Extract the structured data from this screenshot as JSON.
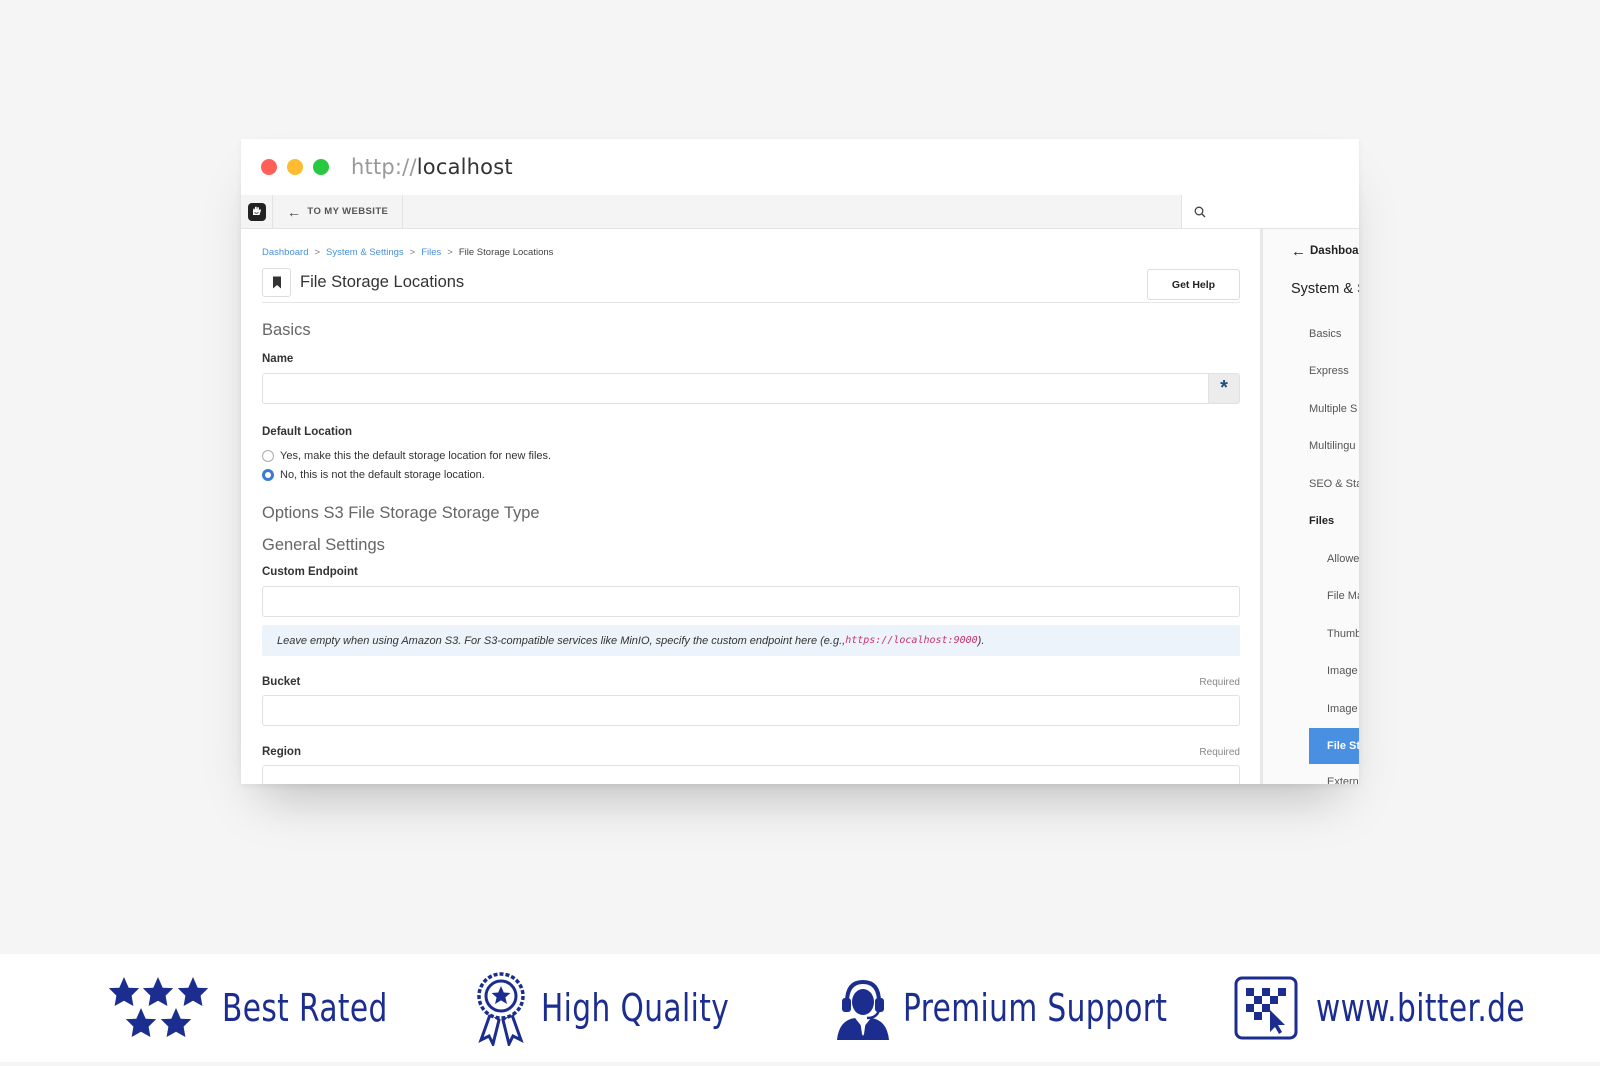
{
  "browser": {
    "url_protocol": "http://",
    "url_host": "localhost",
    "dots": [
      "#ff5f57",
      "#febc2e",
      "#28c840"
    ]
  },
  "toolbar": {
    "back_label": "TO MY WEBSITE",
    "back_icon": "arrow-left-icon",
    "search_icon": "search-icon"
  },
  "breadcrumb": {
    "items": [
      "Dashboard",
      "System & Settings",
      "Files"
    ],
    "separator": ">",
    "current": "File Storage Locations"
  },
  "page": {
    "title": "File Storage Locations",
    "help_button": "Get Help"
  },
  "form": {
    "section_basics": "Basics",
    "name_label": "Name",
    "required_marker": "*",
    "default_location_label": "Default Location",
    "radio_yes": "Yes, make this the default storage location for new files.",
    "radio_no": "No, this is not the default storage location.",
    "radio_selected": "no",
    "section_options": "Options S3 File Storage Storage Type",
    "section_general": "General Settings",
    "custom_endpoint_label": "Custom Endpoint",
    "endpoint_help_before": "Leave empty when using Amazon S3. For S3-compatible services like MinIO, specify the custom endpoint here (e.g., ",
    "endpoint_help_code": "https://localhost:9000",
    "endpoint_help_after": ").",
    "bucket_label": "Bucket",
    "bucket_required": "Required",
    "region_label": "Region",
    "region_required": "Required"
  },
  "sidebar": {
    "back_label": "Dashboar",
    "title": "System & S",
    "items": [
      {
        "label": "Basics"
      },
      {
        "label": "Express"
      },
      {
        "label": "Multiple S"
      },
      {
        "label": "Multilingu"
      },
      {
        "label": "SEO & Sta"
      },
      {
        "label": "Files"
      },
      {
        "label": "Allowe"
      },
      {
        "label": "File Ma"
      },
      {
        "label": "Thumb"
      },
      {
        "label": "Image"
      },
      {
        "label": "Image"
      },
      {
        "label": "File St"
      },
      {
        "label": "Extern"
      }
    ]
  },
  "footer": {
    "badges": [
      {
        "text": "Best Rated",
        "icon": "stars-icon"
      },
      {
        "text": "High Quality",
        "icon": "award-ribbon-icon"
      },
      {
        "text": "Premium Support",
        "icon": "support-agent-icon"
      },
      {
        "text": "www.bitter.de",
        "icon": "bitter-logo-icon"
      }
    ],
    "color": "#1b2d8f"
  },
  "colors": {
    "link": "#4a90d9",
    "active_item": "#4a90e2",
    "code": "#c7336e",
    "help_bg": "#edf3fa"
  }
}
